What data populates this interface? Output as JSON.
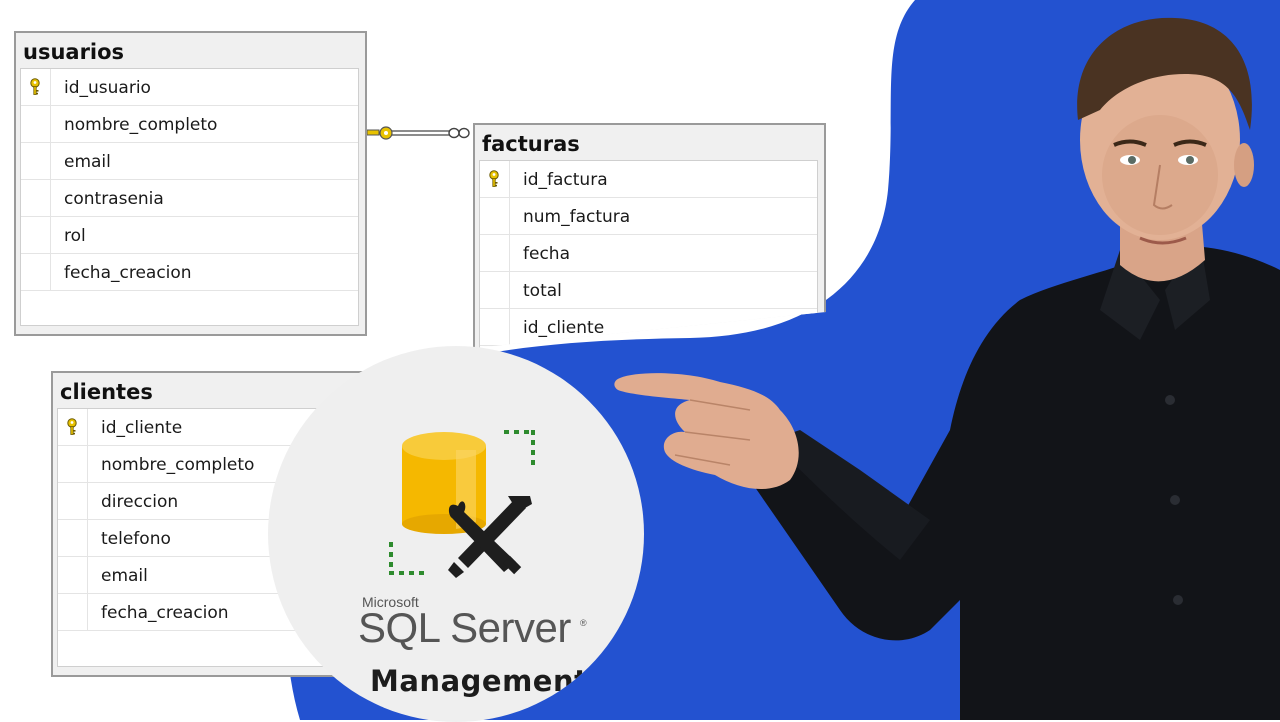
{
  "diagram": {
    "tables": [
      {
        "id": "usuarios",
        "title": "usuarios",
        "columns": [
          {
            "name": "id_usuario",
            "primary_key": true
          },
          {
            "name": "nombre_completo",
            "primary_key": false
          },
          {
            "name": "email",
            "primary_key": false
          },
          {
            "name": "contrasenia",
            "primary_key": false
          },
          {
            "name": "rol",
            "primary_key": false
          },
          {
            "name": "fecha_creacion",
            "primary_key": false
          }
        ]
      },
      {
        "id": "facturas",
        "title": "facturas",
        "columns": [
          {
            "name": "id_factura",
            "primary_key": true
          },
          {
            "name": "num_factura",
            "primary_key": false
          },
          {
            "name": "fecha",
            "primary_key": false
          },
          {
            "name": "total",
            "primary_key": false
          },
          {
            "name": "id_cliente",
            "primary_key": false
          }
        ]
      },
      {
        "id": "clientes",
        "title": "clientes",
        "columns": [
          {
            "name": "id_cliente",
            "primary_key": true
          },
          {
            "name": "nombre_completo",
            "primary_key": false
          },
          {
            "name": "direccion",
            "primary_key": false
          },
          {
            "name": "telefono",
            "primary_key": false
          },
          {
            "name": "email",
            "primary_key": false
          },
          {
            "name": "fecha_creacion",
            "primary_key": false
          }
        ]
      }
    ],
    "relationships": [
      {
        "from": "usuarios",
        "to": "facturas",
        "from_end": "key-icon",
        "to_end": "infinity-icon"
      }
    ]
  },
  "logo": {
    "brand": "Microsoft",
    "product": "SQL Server",
    "registered_mark": "®",
    "subtitle": "Management"
  },
  "colors": {
    "background_blue": "#2352d0",
    "key_yellow": "#e8c200",
    "database_yellow": "#f5b800",
    "dotted_green": "#2e8b2e",
    "table_border": "#9a9a9a",
    "presenter_shirt": "#121418"
  }
}
